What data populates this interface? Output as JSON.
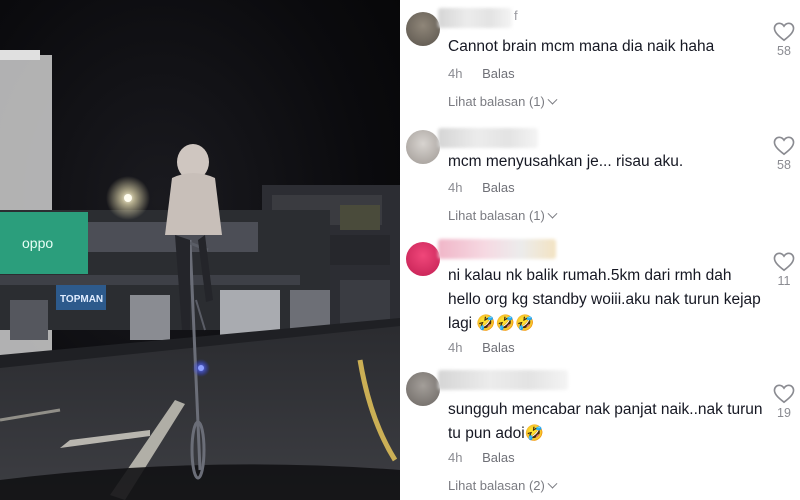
{
  "comments": [
    {
      "username_fragment": "f",
      "text": "Cannot brain mcm mana dia naik haha",
      "time": "4h",
      "reply_label": "Balas",
      "view_replies": "Lihat balasan (1)",
      "likes": "58",
      "avatar_color": "#9c9488"
    },
    {
      "username_fragment": "",
      "text": "mcm menyusahkan je... risau aku.",
      "time": "4h",
      "reply_label": "Balas",
      "view_replies": "Lihat balasan (1)",
      "likes": "58",
      "avatar_color": "#b9b4b0"
    },
    {
      "username_fragment": "",
      "text": "ni kalau nk balik rumah.5km dari rmh dah hello org kg standby woiii.aku nak turun kejap lagi 🤣🤣🤣",
      "time": "4h",
      "reply_label": "Balas",
      "view_replies": "",
      "likes": "11",
      "avatar_color": "#e0336a"
    },
    {
      "username_fragment": "",
      "text": "sungguh mencabar nak panjat naik..nak turun tu pun adoi🤣",
      "time": "4h",
      "reply_label": "Balas",
      "view_replies": "Lihat balasan (2)",
      "likes": "19",
      "avatar_color": "#8f8a86"
    }
  ],
  "video": {
    "shop_sign_1": "oppo",
    "shop_sign_2": "TOPMAN"
  },
  "icons": {
    "like": "heart-outline-icon",
    "expand": "chevron-down-icon"
  }
}
